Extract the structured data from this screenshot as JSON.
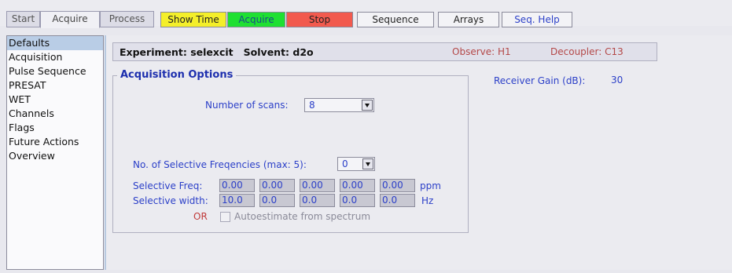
{
  "tabs": [
    {
      "label": "Start"
    },
    {
      "label": "Acquire"
    },
    {
      "label": "Process"
    }
  ],
  "toolbar": {
    "show_time": "Show Time",
    "acquire": "Acquire",
    "stop": "Stop",
    "sequence": "Sequence",
    "arrays": "Arrays",
    "seq_help": "Seq. Help"
  },
  "sidebar": {
    "items": [
      {
        "label": "Defaults",
        "selected": true
      },
      {
        "label": "Acquisition"
      },
      {
        "label": "Pulse Sequence"
      },
      {
        "label": "PRESAT"
      },
      {
        "label": "WET"
      },
      {
        "label": "Channels"
      },
      {
        "label": "Flags"
      },
      {
        "label": "Future Actions"
      },
      {
        "label": "Overview"
      }
    ]
  },
  "header": {
    "experiment": "Experiment: selexcit   Solvent: d2o",
    "observe": "Observe: H1",
    "decoupler": "Decoupler: C13"
  },
  "receiver": {
    "label": "Receiver Gain (dB):",
    "value": "30"
  },
  "acq_options": {
    "title": "Acquisition Options",
    "scans_label": "Number of scans:",
    "scans_value": "8",
    "selfreq_count_label": "No. of Selective Freqencies (max: 5):",
    "selfreq_count_value": "0",
    "selfreq_label": "Selective Freq:",
    "selfreq_values": [
      "0.00",
      "0.00",
      "0.00",
      "0.00",
      "0.00"
    ],
    "selfreq_unit": "ppm",
    "selwidth_label": "Selective width:",
    "selwidth_values": [
      "10.0",
      "0.0",
      "0.0",
      "0.0",
      "0.0"
    ],
    "selwidth_unit": "Hz",
    "or_label": "OR",
    "autoestimate_label": "Autoestimate from spectrum",
    "autoestimate_checked": false
  }
}
